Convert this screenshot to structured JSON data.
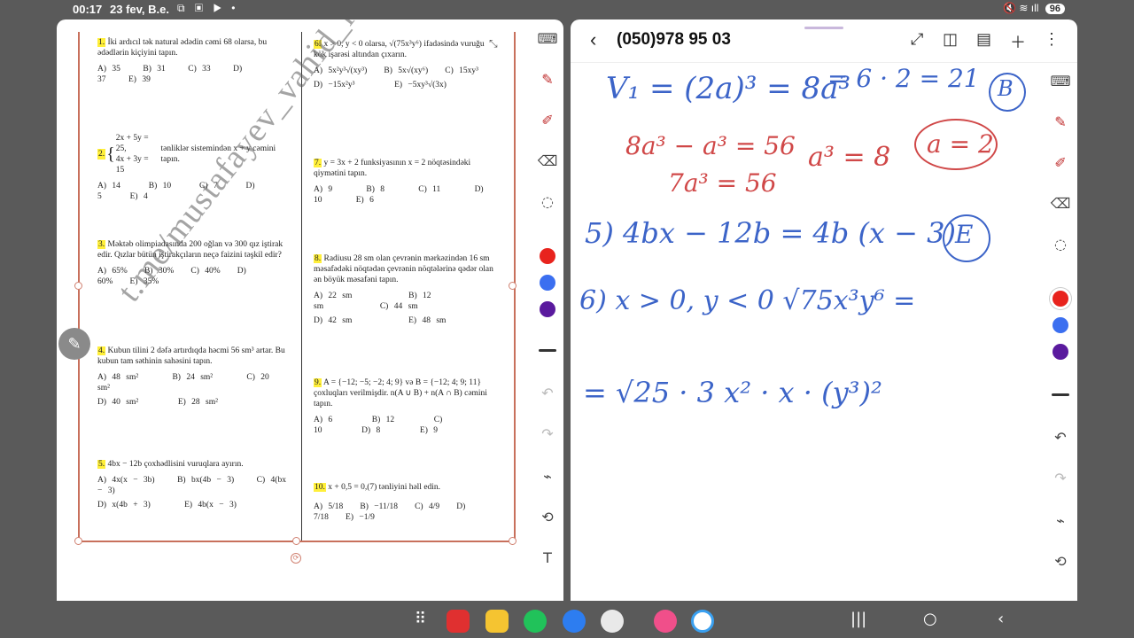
{
  "status": {
    "time": "00:17",
    "date": "23 fev, B.e.",
    "battery": "96"
  },
  "watermark": "t.me/mustafayev_vahid_riyaziyyat",
  "questions_left": [
    {
      "num": "1.",
      "text": "İki ardıcıl tək natural ədədin cəmi 68 olarsa, bu ədədlərin kiçiyini tapın.",
      "options": [
        "A) 35",
        "B) 31",
        "C) 33",
        "D) 37",
        "E) 39"
      ]
    },
    {
      "num": "2.",
      "text_sys1": "2x + 5y = 25,",
      "text_sys2": "4x + 3y = 15",
      "text": "tənliklər sistemindən x + y cəmini tapın.",
      "options": [
        "A) 14",
        "B) 10",
        "C) 7",
        "D) 5",
        "E) 4"
      ]
    },
    {
      "num": "3.",
      "text": "Məktəb olimpiadasında 200 oğlan və 300 qız iştirak edir. Qızlar bütün iştirakçıların neçə faizini təşkil edir?",
      "options": [
        "A) 65%",
        "B) 30%",
        "C) 40%",
        "D) 60%",
        "E) 35%"
      ]
    },
    {
      "num": "4.",
      "text": "Kubun tilini 2 dəfə artırdıqda həcmi 56 sm³ artar. Bu kubun tam səthinin sahəsini tapın.",
      "options": [
        "A) 48 sm²",
        "B) 24 sm²",
        "C) 20 sm²",
        "D) 40 sm²",
        "E) 28 sm²"
      ]
    },
    {
      "num": "5.",
      "text": "4bx − 12b çoxhədlisini vuruqlara ayırın.",
      "options": [
        "A) 4x(x − 3b)",
        "B) bx(4b − 3)",
        "C) 4(bx − 3)",
        "D) x(4b + 3)",
        "E) 4b(x − 3)"
      ]
    }
  ],
  "questions_right": [
    {
      "num": "6.",
      "text": "x > 0, y < 0 olarsa, √(75x³y⁶) ifadəsində vuruğu kök işarəsi altından çıxarın.",
      "options": [
        "A) 5x²y³√(xy³)",
        "B) 5x√(xy⁶)",
        "C) 15xy³",
        "D) −15x²y³",
        "E) −5xy³√(3x)"
      ]
    },
    {
      "num": "7.",
      "text": "y = 3x + 2 funksiyasının x = 2 nöqtəsindəki qiymətini tapın.",
      "options": [
        "A) 9",
        "B) 8",
        "C) 11",
        "D) 10",
        "E) 6"
      ]
    },
    {
      "num": "8.",
      "text": "Radiusu 28 sm olan çevrənin mərkəzindən 16 sm məsafədəki nöqtədən çevrənin nöqtələrinə qədər olan ən böyük məsafəni tapın.",
      "options": [
        "A) 22 sm",
        "B) 12 sm",
        "C) 44 sm",
        "D) 42 sm",
        "E) 48 sm"
      ]
    },
    {
      "num": "9.",
      "text": "A = {−12; −5; −2; 4; 9} və B = {−12; 4; 9; 11} çoxluqları verilmişdir. n(A ∪ B) + n(A ∩ B) cəmini tapın.",
      "options": [
        "A) 6",
        "B) 12",
        "C) 10",
        "D) 8",
        "E) 9"
      ]
    },
    {
      "num": "10.",
      "text": "x + 0,5 = 0,(7) tənliyini həll edin.",
      "options": [
        "A) 5/18",
        "B) −11/18",
        "C) 4/9",
        "D) 7/18",
        "E) −1/9"
      ]
    }
  ],
  "notes": {
    "title": "(050)978 95 03",
    "lines": [
      "V₁ = (2a)³ = 8a³",
      "= 6 · 2 = 21",
      "B",
      "8a³ − a³ = 56",
      "7a³ = 56",
      "a³ = 8",
      "a = 2",
      "5)  4bx − 12b = 4b (x − 3)",
      "E",
      "6)  x > 0,  y < 0   √75x³y⁶   =",
      "= √25 · 3  x² · x  · (y³)²"
    ]
  },
  "colors": {
    "red": "#e8231d",
    "blue": "#3b6ff0",
    "purple": "#5a1a9e",
    "ink_blue": "#3c64c8",
    "ink_red": "#d04848"
  }
}
